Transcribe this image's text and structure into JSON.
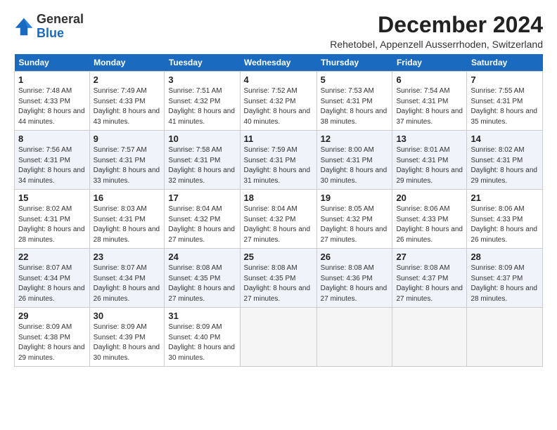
{
  "logo": {
    "general": "General",
    "blue": "Blue"
  },
  "title": "December 2024",
  "subtitle": "Rehetobel, Appenzell Ausserrhoden, Switzerland",
  "days_of_week": [
    "Sunday",
    "Monday",
    "Tuesday",
    "Wednesday",
    "Thursday",
    "Friday",
    "Saturday"
  ],
  "weeks": [
    [
      {
        "day": "1",
        "sunrise": "7:48 AM",
        "sunset": "4:33 PM",
        "daylight": "8 hours and 44 minutes."
      },
      {
        "day": "2",
        "sunrise": "7:49 AM",
        "sunset": "4:33 PM",
        "daylight": "8 hours and 43 minutes."
      },
      {
        "day": "3",
        "sunrise": "7:51 AM",
        "sunset": "4:32 PM",
        "daylight": "8 hours and 41 minutes."
      },
      {
        "day": "4",
        "sunrise": "7:52 AM",
        "sunset": "4:32 PM",
        "daylight": "8 hours and 40 minutes."
      },
      {
        "day": "5",
        "sunrise": "7:53 AM",
        "sunset": "4:31 PM",
        "daylight": "8 hours and 38 minutes."
      },
      {
        "day": "6",
        "sunrise": "7:54 AM",
        "sunset": "4:31 PM",
        "daylight": "8 hours and 37 minutes."
      },
      {
        "day": "7",
        "sunrise": "7:55 AM",
        "sunset": "4:31 PM",
        "daylight": "8 hours and 35 minutes."
      }
    ],
    [
      {
        "day": "8",
        "sunrise": "7:56 AM",
        "sunset": "4:31 PM",
        "daylight": "8 hours and 34 minutes."
      },
      {
        "day": "9",
        "sunrise": "7:57 AM",
        "sunset": "4:31 PM",
        "daylight": "8 hours and 33 minutes."
      },
      {
        "day": "10",
        "sunrise": "7:58 AM",
        "sunset": "4:31 PM",
        "daylight": "8 hours and 32 minutes."
      },
      {
        "day": "11",
        "sunrise": "7:59 AM",
        "sunset": "4:31 PM",
        "daylight": "8 hours and 31 minutes."
      },
      {
        "day": "12",
        "sunrise": "8:00 AM",
        "sunset": "4:31 PM",
        "daylight": "8 hours and 30 minutes."
      },
      {
        "day": "13",
        "sunrise": "8:01 AM",
        "sunset": "4:31 PM",
        "daylight": "8 hours and 29 minutes."
      },
      {
        "day": "14",
        "sunrise": "8:02 AM",
        "sunset": "4:31 PM",
        "daylight": "8 hours and 29 minutes."
      }
    ],
    [
      {
        "day": "15",
        "sunrise": "8:02 AM",
        "sunset": "4:31 PM",
        "daylight": "8 hours and 28 minutes."
      },
      {
        "day": "16",
        "sunrise": "8:03 AM",
        "sunset": "4:31 PM",
        "daylight": "8 hours and 28 minutes."
      },
      {
        "day": "17",
        "sunrise": "8:04 AM",
        "sunset": "4:32 PM",
        "daylight": "8 hours and 27 minutes."
      },
      {
        "day": "18",
        "sunrise": "8:04 AM",
        "sunset": "4:32 PM",
        "daylight": "8 hours and 27 minutes."
      },
      {
        "day": "19",
        "sunrise": "8:05 AM",
        "sunset": "4:32 PM",
        "daylight": "8 hours and 27 minutes."
      },
      {
        "day": "20",
        "sunrise": "8:06 AM",
        "sunset": "4:33 PM",
        "daylight": "8 hours and 26 minutes."
      },
      {
        "day": "21",
        "sunrise": "8:06 AM",
        "sunset": "4:33 PM",
        "daylight": "8 hours and 26 minutes."
      }
    ],
    [
      {
        "day": "22",
        "sunrise": "8:07 AM",
        "sunset": "4:34 PM",
        "daylight": "8 hours and 26 minutes."
      },
      {
        "day": "23",
        "sunrise": "8:07 AM",
        "sunset": "4:34 PM",
        "daylight": "8 hours and 26 minutes."
      },
      {
        "day": "24",
        "sunrise": "8:08 AM",
        "sunset": "4:35 PM",
        "daylight": "8 hours and 27 minutes."
      },
      {
        "day": "25",
        "sunrise": "8:08 AM",
        "sunset": "4:35 PM",
        "daylight": "8 hours and 27 minutes."
      },
      {
        "day": "26",
        "sunrise": "8:08 AM",
        "sunset": "4:36 PM",
        "daylight": "8 hours and 27 minutes."
      },
      {
        "day": "27",
        "sunrise": "8:08 AM",
        "sunset": "4:37 PM",
        "daylight": "8 hours and 27 minutes."
      },
      {
        "day": "28",
        "sunrise": "8:09 AM",
        "sunset": "4:37 PM",
        "daylight": "8 hours and 28 minutes."
      }
    ],
    [
      {
        "day": "29",
        "sunrise": "8:09 AM",
        "sunset": "4:38 PM",
        "daylight": "8 hours and 29 minutes."
      },
      {
        "day": "30",
        "sunrise": "8:09 AM",
        "sunset": "4:39 PM",
        "daylight": "8 hours and 30 minutes."
      },
      {
        "day": "31",
        "sunrise": "8:09 AM",
        "sunset": "4:40 PM",
        "daylight": "8 hours and 30 minutes."
      },
      null,
      null,
      null,
      null
    ]
  ]
}
